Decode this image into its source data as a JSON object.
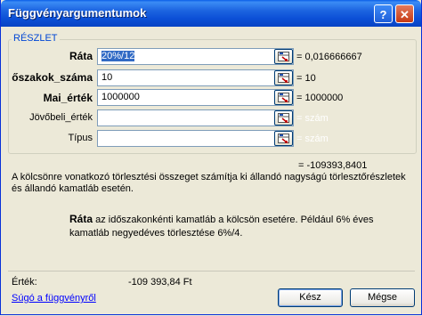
{
  "window": {
    "title": "Függvényargumentumok",
    "help_glyph": "?",
    "close_glyph": "✕"
  },
  "group": {
    "label": "RÉSZLET"
  },
  "args": [
    {
      "label": "Ráta",
      "required": true,
      "input": "20%/12",
      "value": "= 0,016666667"
    },
    {
      "label": "őszakok_száma",
      "required": true,
      "input": "10",
      "value": "= 10"
    },
    {
      "label": "Mai_érték",
      "required": true,
      "input": "1000000",
      "value": "= 1000000"
    },
    {
      "label": "Jövőbeli_érték",
      "required": false,
      "input": "",
      "value": "= szám"
    },
    {
      "label": "Típus",
      "required": false,
      "input": "",
      "value": "= szám"
    }
  ],
  "result": "= -109393,8401",
  "description": "A kölcsönre vonatkozó törlesztési összeget számítja ki állandó nagyságú törlesztőrészletek és állandó kamatláb esetén.",
  "arg_help": {
    "name": "Ráta",
    "text": "az időszakonkénti kamatláb a kölcsön esetére. Például 6% éves kamatláb negyedéves törlesztése 6%/4."
  },
  "footer": {
    "value_label": "Érték:",
    "value": "-109 393,84 Ft",
    "help_link": "Súgó a függvényről",
    "ok": "Kész",
    "cancel": "Mégse"
  }
}
